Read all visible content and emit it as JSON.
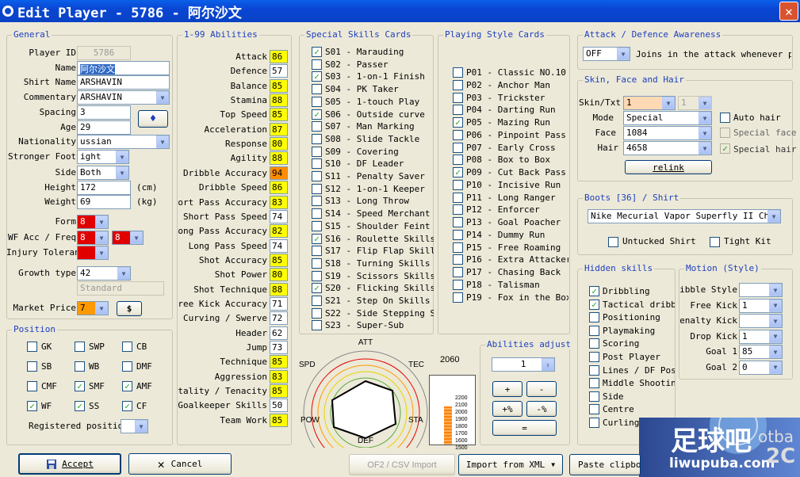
{
  "window": {
    "title": "Edit Player - 5786 - 阿尔沙文",
    "close_label": "✕"
  },
  "general": {
    "title": "General",
    "player_id_label": "Player ID",
    "player_id": "5786",
    "name_label": "Name",
    "name": "阿尔沙文",
    "shirt_name_label": "Shirt Name",
    "shirt_name": "ARSHAVIN",
    "commentary_label": "Commentary",
    "commentary": "ARSHAVIN",
    "spacing_label": "Spacing",
    "spacing": "3",
    "age_label": "Age",
    "age": "29",
    "nationality_label": "Nationality",
    "nationality": "ussian",
    "stronger_foot_label": "Stronger Foot",
    "stronger_foot": "ight",
    "side_label": "Side",
    "side": "Both",
    "height_label": "Height",
    "height": "172",
    "height_unit": "(cm)",
    "weight_label": "Weight",
    "weight": "69",
    "weight_unit": "(kg)",
    "form_label": "Form",
    "form": "8",
    "wf_label": "WF Acc / Freq",
    "wf_acc": "8",
    "wf_freq": "8",
    "injury_label": "Injury Tolerance",
    "injury": "",
    "growth_label": "Growth type",
    "growth": "42",
    "growth_desc": "Standard",
    "market_label": "Market Price",
    "market": "7",
    "market_btn": "$",
    "swap_icon": "♦"
  },
  "position": {
    "title": "Position",
    "items": [
      {
        "label": "GK",
        "checked": false
      },
      {
        "label": "SWP",
        "checked": false
      },
      {
        "label": "CB",
        "checked": false
      },
      {
        "label": "SB",
        "checked": false
      },
      {
        "label": "WB",
        "checked": false
      },
      {
        "label": "DMF",
        "checked": false
      },
      {
        "label": "CMF",
        "checked": false
      },
      {
        "label": "SMF",
        "checked": true
      },
      {
        "label": "AMF",
        "checked": true
      },
      {
        "label": "WF",
        "checked": true
      },
      {
        "label": "SS",
        "checked": true
      },
      {
        "label": "CF",
        "checked": true
      }
    ],
    "registered_label": "Registered position",
    "registered": ""
  },
  "abilities": {
    "title": "1-99 Abilities",
    "items": [
      {
        "label": "Attack",
        "value": "86",
        "color": "#ffff00"
      },
      {
        "label": "Defence",
        "value": "57",
        "color": "#ffffff"
      },
      {
        "label": "Balance",
        "value": "85",
        "color": "#ffff00"
      },
      {
        "label": "Stamina",
        "value": "88",
        "color": "#ffff00"
      },
      {
        "label": "Top Speed",
        "value": "85",
        "color": "#ffff00"
      },
      {
        "label": "Acceleration",
        "value": "87",
        "color": "#ffff00"
      },
      {
        "label": "Response",
        "value": "80",
        "color": "#ffff00"
      },
      {
        "label": "Agility",
        "value": "88",
        "color": "#ffff00"
      },
      {
        "label": "Dribble Accuracy",
        "value": "94",
        "color": "#ff8c00"
      },
      {
        "label": "Dribble Speed",
        "value": "86",
        "color": "#ffff00"
      },
      {
        "label": "Short Pass Accuracy",
        "value": "83",
        "color": "#ffff00"
      },
      {
        "label": "Short Pass Speed",
        "value": "74",
        "color": "#ffffff"
      },
      {
        "label": "Long Pass Accuracy",
        "value": "82",
        "color": "#ffff00"
      },
      {
        "label": "Long Pass Speed",
        "value": "74",
        "color": "#ffffff"
      },
      {
        "label": "Shot Accuracy",
        "value": "85",
        "color": "#ffff00"
      },
      {
        "label": "Shot Power",
        "value": "80",
        "color": "#ffff00"
      },
      {
        "label": "Shot Technique",
        "value": "88",
        "color": "#ffff00"
      },
      {
        "label": "Free Kick Accuracy",
        "value": "71",
        "color": "#ffffff"
      },
      {
        "label": "Curving / Swerve",
        "value": "72",
        "color": "#ffffff"
      },
      {
        "label": "Header",
        "value": "62",
        "color": "#ffffff"
      },
      {
        "label": "Jump",
        "value": "73",
        "color": "#ffffff"
      },
      {
        "label": "Technique",
        "value": "85",
        "color": "#ffff00"
      },
      {
        "label": "Aggression",
        "value": "83",
        "color": "#ffff00"
      },
      {
        "label": "Mentality / Tenacity",
        "value": "85",
        "color": "#ffff00"
      },
      {
        "label": "Goalkeeper Skills",
        "value": "50",
        "color": "#ffffff"
      },
      {
        "label": "Team Work",
        "value": "85",
        "color": "#ffff00"
      }
    ]
  },
  "special_skills": {
    "title": "Special Skills Cards",
    "items": [
      {
        "label": "S01 - Marauding",
        "checked": true
      },
      {
        "label": "S02 - Passer",
        "checked": false
      },
      {
        "label": "S03 - 1-on-1 Finish",
        "checked": true
      },
      {
        "label": "S04 - PK Taker",
        "checked": false
      },
      {
        "label": "S05 - 1-touch Play",
        "checked": false
      },
      {
        "label": "S06 - Outside curve",
        "checked": true
      },
      {
        "label": "S07 - Man Marking",
        "checked": false
      },
      {
        "label": "S08 - Slide Tackle",
        "checked": false
      },
      {
        "label": "S09 - Covering",
        "checked": false
      },
      {
        "label": "S10 - DF Leader",
        "checked": false
      },
      {
        "label": "S11 - Penalty Saver",
        "checked": false
      },
      {
        "label": "S12 - 1-on-1 Keeper",
        "checked": false
      },
      {
        "label": "S13 - Long Throw",
        "checked": false
      },
      {
        "label": "S14 - Speed Merchant",
        "checked": false
      },
      {
        "label": "S15 - Shoulder Feint Sk",
        "checked": false
      },
      {
        "label": "S16 - Roulette Skills",
        "checked": true
      },
      {
        "label": "S17 - Flip Flap Skills",
        "checked": false
      },
      {
        "label": "S18 - Turning Skills",
        "checked": false
      },
      {
        "label": "S19 - Scissors Skills",
        "checked": false
      },
      {
        "label": "S20 - Flicking Skills",
        "checked": true
      },
      {
        "label": "S21 - Step On Skills",
        "checked": false
      },
      {
        "label": "S22 - Side Stepping Ski",
        "checked": false
      },
      {
        "label": "S23 - Super-Sub",
        "checked": false
      }
    ]
  },
  "playing_style": {
    "title": "Playing Style Cards",
    "items": [
      {
        "label": "P01 - Classic NO.10",
        "checked": false
      },
      {
        "label": "P02 - Anchor Man",
        "checked": false
      },
      {
        "label": "P03 - Trickster",
        "checked": false
      },
      {
        "label": "P04 - Darting Run",
        "checked": false
      },
      {
        "label": "P05 - Mazing Run",
        "checked": true
      },
      {
        "label": "P06 - Pinpoint Pass",
        "checked": false
      },
      {
        "label": "P07 - Early Cross",
        "checked": false
      },
      {
        "label": "P08 - Box to Box",
        "checked": false
      },
      {
        "label": "P09 - Cut Back Pass",
        "checked": true
      },
      {
        "label": "P10 - Incisive Run",
        "checked": false
      },
      {
        "label": "P11 - Long Ranger",
        "checked": false
      },
      {
        "label": "P12 - Enforcer",
        "checked": false
      },
      {
        "label": "P13 - Goal Poacher",
        "checked": false
      },
      {
        "label": "P14 - Dummy Run",
        "checked": false
      },
      {
        "label": "P15 - Free Roaming",
        "checked": false
      },
      {
        "label": "P16 - Extra Attacker",
        "checked": false
      },
      {
        "label": "P17 - Chasing Back",
        "checked": false
      },
      {
        "label": "P18 - Talisman",
        "checked": false
      },
      {
        "label": "P19 - Fox in the Box",
        "checked": false
      }
    ]
  },
  "radar": {
    "att": "ATT",
    "spd": "SPD",
    "tec": "TEC",
    "pow": "POW",
    "sta": "STA",
    "def": "DEF"
  },
  "bar": {
    "total": "2060",
    "ticks": [
      "2200",
      "2100",
      "2000",
      "1900",
      "1800",
      "1700",
      "1600",
      "1500"
    ],
    "fill_fraction": 0.55
  },
  "abilities_adjust": {
    "title": "Abilities adjust",
    "value": "1",
    "plus": "+",
    "minus": "-",
    "plus_pct": "+%",
    "minus_pct": "-%",
    "equals": "="
  },
  "awareness": {
    "title": "Attack / Defence Awareness",
    "value": "OFF",
    "desc": "Joins in the attack whenever poss"
  },
  "skin": {
    "title": "Skin, Face and Hair",
    "skin_label": "Skin/Txt",
    "skin": "1",
    "skin2": "1",
    "mode_label": "Mode",
    "mode": "Special",
    "face_label": "Face",
    "face": "1084",
    "hair_label": "Hair",
    "hair": "4658",
    "relink": "relink",
    "auto_hair": "Auto hair",
    "special_face": "Special face",
    "special_hair": "Special hair",
    "skin_color": "#ffd9b3"
  },
  "boots": {
    "title": "Boots [36] / Shirt",
    "value": "Nike Mecurial Vapor Superfly II Cher",
    "untucked": "Untucked Shirt",
    "tight": "Tight Kit"
  },
  "hidden": {
    "title": "Hidden skills",
    "items": [
      {
        "label": "Dribbling",
        "checked": true
      },
      {
        "label": "Tactical dribbl",
        "checked": true
      },
      {
        "label": "Positioning",
        "checked": false
      },
      {
        "label": "Playmaking",
        "checked": false
      },
      {
        "label": "Scoring",
        "checked": false
      },
      {
        "label": "Post Player",
        "checked": false
      },
      {
        "label": "Lines / DF Pos.",
        "checked": false
      },
      {
        "label": "Middle Shooting",
        "checked": false
      },
      {
        "label": "Side",
        "checked": false
      },
      {
        "label": "Centre",
        "checked": false
      },
      {
        "label": "Curling",
        "checked": false
      }
    ]
  },
  "motion": {
    "title": "Motion (Style)",
    "items": [
      {
        "label": "Dribble Style",
        "value": ""
      },
      {
        "label": "Free Kick",
        "value": "1"
      },
      {
        "label": "Penalty Kick.",
        "value": ""
      },
      {
        "label": "Drop Kick",
        "value": "1"
      },
      {
        "label": "Goal 1",
        "value": "85"
      },
      {
        "label": "Goal 2",
        "value": "0"
      }
    ]
  },
  "footer": {
    "accept": "Accept",
    "cancel": "Cancel",
    "of2csv": "OF2 / CSV Import",
    "import_xml": "Import from XML",
    "paste": "Paste clipboa"
  },
  "logo": {
    "main": "足球吧",
    "sub": "liwupuba.com",
    "side": "otba",
    "year": "2C"
  }
}
